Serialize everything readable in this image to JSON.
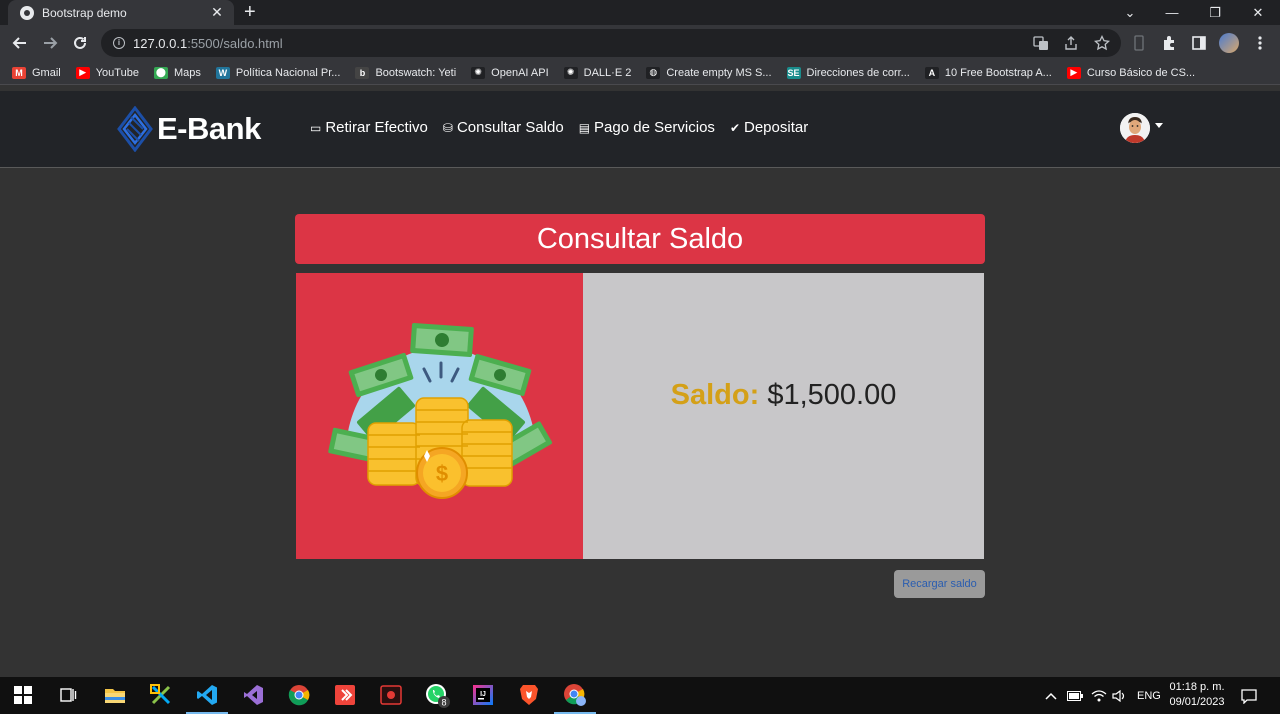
{
  "browser": {
    "tab_title": "Bootstrap demo",
    "tab_close": "✕",
    "new_tab": "+",
    "url_host": "127.0.0.1",
    "url_path": ":5500/saldo.html",
    "window_controls": [
      "⌄",
      "—",
      "❐",
      "✕"
    ],
    "bookmarks": [
      {
        "label": "Gmail",
        "icon": "gmail-icon",
        "color": "#ea4335",
        "glyph": "M"
      },
      {
        "label": "YouTube",
        "icon": "youtube-icon",
        "color": "#ff0000",
        "glyph": "▶"
      },
      {
        "label": "Maps",
        "icon": "maps-icon",
        "color": "#34a853",
        "glyph": "⬤"
      },
      {
        "label": "Política Nacional Pr...",
        "icon": "wordpress-icon",
        "color": "#21759b",
        "glyph": "W"
      },
      {
        "label": "Bootswatch: Yeti",
        "icon": "bootswatch-icon",
        "color": "#444444",
        "glyph": "b"
      },
      {
        "label": "OpenAI API",
        "icon": "openai-icon",
        "color": "#202124",
        "glyph": "✺"
      },
      {
        "label": "DALL·E 2",
        "icon": "openai-icon",
        "color": "#202124",
        "glyph": "✺"
      },
      {
        "label": "Create empty MS S...",
        "icon": "globe-icon",
        "color": "#202124",
        "glyph": "◍"
      },
      {
        "label": "Direcciones de corr...",
        "icon": "site-icon",
        "color": "#1a8c8c",
        "glyph": "SE"
      },
      {
        "label": "10 Free Bootstrap A...",
        "icon": "a-icon",
        "color": "#202124",
        "glyph": "A"
      },
      {
        "label": "Curso Básico de CS...",
        "icon": "youtube-icon",
        "color": "#ff0000",
        "glyph": "▶"
      }
    ]
  },
  "navbar": {
    "brand": "E-Bank",
    "links": [
      {
        "label": "Retirar Efectivo",
        "icon": "terminal-icon",
        "glyph": "▭"
      },
      {
        "label": "Consultar Saldo",
        "icon": "coins-icon",
        "glyph": "⛁"
      },
      {
        "label": "Pago de Servicios",
        "icon": "receipt-icon",
        "glyph": "▤"
      },
      {
        "label": "Depositar",
        "icon": "check-circle-icon",
        "glyph": "✔"
      }
    ]
  },
  "main": {
    "title": "Consultar Saldo",
    "saldo_label": "Saldo:",
    "saldo_value": "$1,500.00",
    "reload_button": "Recargar saldo"
  },
  "colors": {
    "accent_red": "#dc3545",
    "saldo_gold": "#d4a017",
    "card_gray": "#c8c7c9",
    "navbar_dark": "#222428"
  },
  "taskbar": {
    "language": "ENG",
    "time": "01:18 p. m.",
    "date": "09/01/2023",
    "whatsapp_badge": "8"
  }
}
